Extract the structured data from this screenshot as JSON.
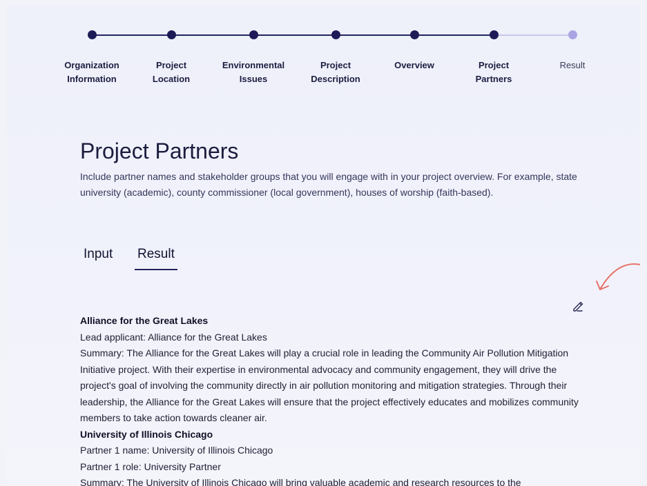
{
  "stepper": {
    "steps": [
      {
        "label": "Organization\nInformation",
        "status": "done"
      },
      {
        "label": "Project\nLocation",
        "status": "done"
      },
      {
        "label": "Environmental\nIssues",
        "status": "done"
      },
      {
        "label": "Project\nDescription",
        "status": "done"
      },
      {
        "label": "Overview",
        "status": "done"
      },
      {
        "label": "Project\nPartners",
        "status": "current"
      },
      {
        "label": "Result",
        "status": "pending"
      }
    ],
    "colors": {
      "done": "#1c1a57",
      "pending": "#aaa5e2"
    }
  },
  "page": {
    "title": "Project Partners",
    "description": "Include partner names and stakeholder groups that you will engage with in your project overview. For example, state university (academic), county commissioner (local government), houses of worship (faith-based)."
  },
  "tabs": {
    "input_label": "Input",
    "result_label": "Result",
    "active": "Result"
  },
  "icons": {
    "edit": "pencil-icon",
    "annotation": "curved-arrow-icon"
  },
  "accent_color": "#e8736b",
  "result": {
    "org1_name": "Alliance for the Great Lakes",
    "org1_lead": "Lead applicant: Alliance for the Great Lakes",
    "org1_summary": "Summary: The Alliance for the Great Lakes will play a crucial role in leading the Community Air Pollution Mitigation Initiative project. With their expertise in environmental advocacy and community engagement, they will drive the project's goal of involving the community directly in air pollution monitoring and mitigation strategies. Through their leadership, the Alliance for the Great Lakes will ensure that the project effectively educates and mobilizes community members to take action towards cleaner air.",
    "org2_name": "University of Illinois Chicago",
    "org2_partner_name": "Partner 1 name: University of Illinois Chicago",
    "org2_partner_role": "Partner 1 role: University Partner",
    "org2_summary": "Summary: The University of Illinois Chicago will bring valuable academic and research resources to the"
  }
}
